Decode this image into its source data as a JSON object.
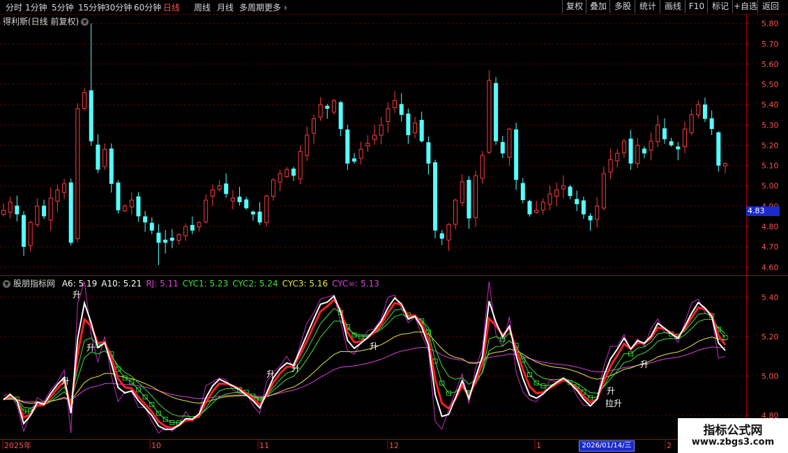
{
  "toolbar": {
    "periods": [
      "分时",
      "1分钟",
      "5分钟",
      "15分钟",
      "30分钟",
      "60分钟",
      "日线",
      "周线",
      "月线",
      "多周期",
      "更多"
    ],
    "active_period": "日线",
    "buttons": [
      "复权",
      "叠加",
      "多股",
      "统计",
      "画线",
      "F10",
      "标记",
      "+自选",
      "返回"
    ]
  },
  "main": {
    "title": "得利斯(日线 前复权)",
    "current_price": "4.83",
    "axis_labels": [
      "5.80",
      "5.70",
      "5.60",
      "5.50",
      "5.40",
      "5.30",
      "5.20",
      "5.10",
      "5.00",
      "4.90",
      "4.80",
      "4.70",
      "4.60"
    ]
  },
  "indicator": {
    "name": "股朋指标网",
    "values": [
      {
        "label": "A6: 5.19",
        "color": "#ffffff"
      },
      {
        "label": "A10: 5.21",
        "color": "#ffffff"
      },
      {
        "label": "RJ: 5.11",
        "color": "#e040e0"
      },
      {
        "label": "CYC1: 5.23",
        "color": "#40e040"
      },
      {
        "label": "CYC2: 5.24",
        "color": "#40e040"
      },
      {
        "label": "CYC3: 5.16",
        "color": "#e6e640"
      },
      {
        "label": "CYC∞: 5.13",
        "color": "#e040e0"
      }
    ],
    "axis_labels": [
      "5.40",
      "5.20",
      "5.00",
      "4.80"
    ],
    "signals": [
      "升",
      "升",
      "升",
      "升",
      "升",
      "升",
      "升",
      "升",
      "拉升"
    ]
  },
  "date_axis": {
    "labels": [
      "2025年",
      "10",
      "11",
      "12",
      "1",
      "2"
    ],
    "selected_date": "2026/01/14/三"
  },
  "watermark": {
    "title": "指标公式网",
    "url": "www.zbgs3.com"
  },
  "colors": {
    "up": "#ff3c3c",
    "down": "#54ffff",
    "grid": "#7a0000",
    "border": "#b00000",
    "axis_text": "#ff5050"
  },
  "chart_data": [
    {
      "type": "candlestick",
      "title": "得利斯(日线 前复权)",
      "ylim": [
        4.57,
        5.84
      ],
      "y_ticks": [
        5.8,
        5.7,
        5.6,
        5.5,
        5.4,
        5.3,
        5.2,
        5.1,
        5.0,
        4.9,
        4.8,
        4.7,
        4.6
      ],
      "closes": [
        4.88,
        4.92,
        4.86,
        4.7,
        4.82,
        4.9,
        4.85,
        4.94,
        4.98,
        5.01,
        4.72,
        5.38,
        5.46,
        5.22,
        5.08,
        5.18,
        5.01,
        4.88,
        4.9,
        4.93,
        4.85,
        4.82,
        4.78,
        4.72,
        4.72,
        4.73,
        4.76,
        4.8,
        4.78,
        4.82,
        4.93,
        4.98,
        5.0,
        4.96,
        4.94,
        4.92,
        4.89,
        4.86,
        4.82,
        4.95,
        5.03,
        5.06,
        5.08,
        5.05,
        5.17,
        5.25,
        5.33,
        5.4,
        5.38,
        5.42,
        5.28,
        5.11,
        5.12,
        5.18,
        5.21,
        5.25,
        5.3,
        5.38,
        5.42,
        5.35,
        5.25,
        5.31,
        5.22,
        5.11,
        4.78,
        4.74,
        4.81,
        4.93,
        5.02,
        4.84,
        5.05,
        5.15,
        5.52,
        5.22,
        5.16,
        5.28,
        5.03,
        4.93,
        4.86,
        4.88,
        4.92,
        4.96,
        4.98,
        5.0,
        4.95,
        4.91,
        4.86,
        4.83,
        4.9,
        5.06,
        5.13,
        5.16,
        5.22,
        5.11,
        5.2,
        5.16,
        5.22,
        5.3,
        5.23,
        5.2,
        5.18,
        5.28,
        5.35,
        5.4,
        5.33,
        5.28,
        5.1,
        5.11
      ],
      "ohlc_source": "estimated from chart pixels"
    },
    {
      "type": "line",
      "title": "股朋指标网",
      "ylim": [
        4.68,
        5.5
      ],
      "y_ticks": [
        5.4,
        5.2,
        5.0,
        4.8
      ],
      "series": [
        {
          "name": "A6",
          "value": 5.19
        },
        {
          "name": "A10",
          "value": 5.21
        },
        {
          "name": "RJ",
          "value": 5.11
        },
        {
          "name": "CYC1",
          "value": 5.23
        },
        {
          "name": "CYC2",
          "value": 5.24
        },
        {
          "name": "CYC3",
          "value": 5.16
        },
        {
          "name": "CYC∞",
          "value": 5.13
        }
      ]
    }
  ]
}
